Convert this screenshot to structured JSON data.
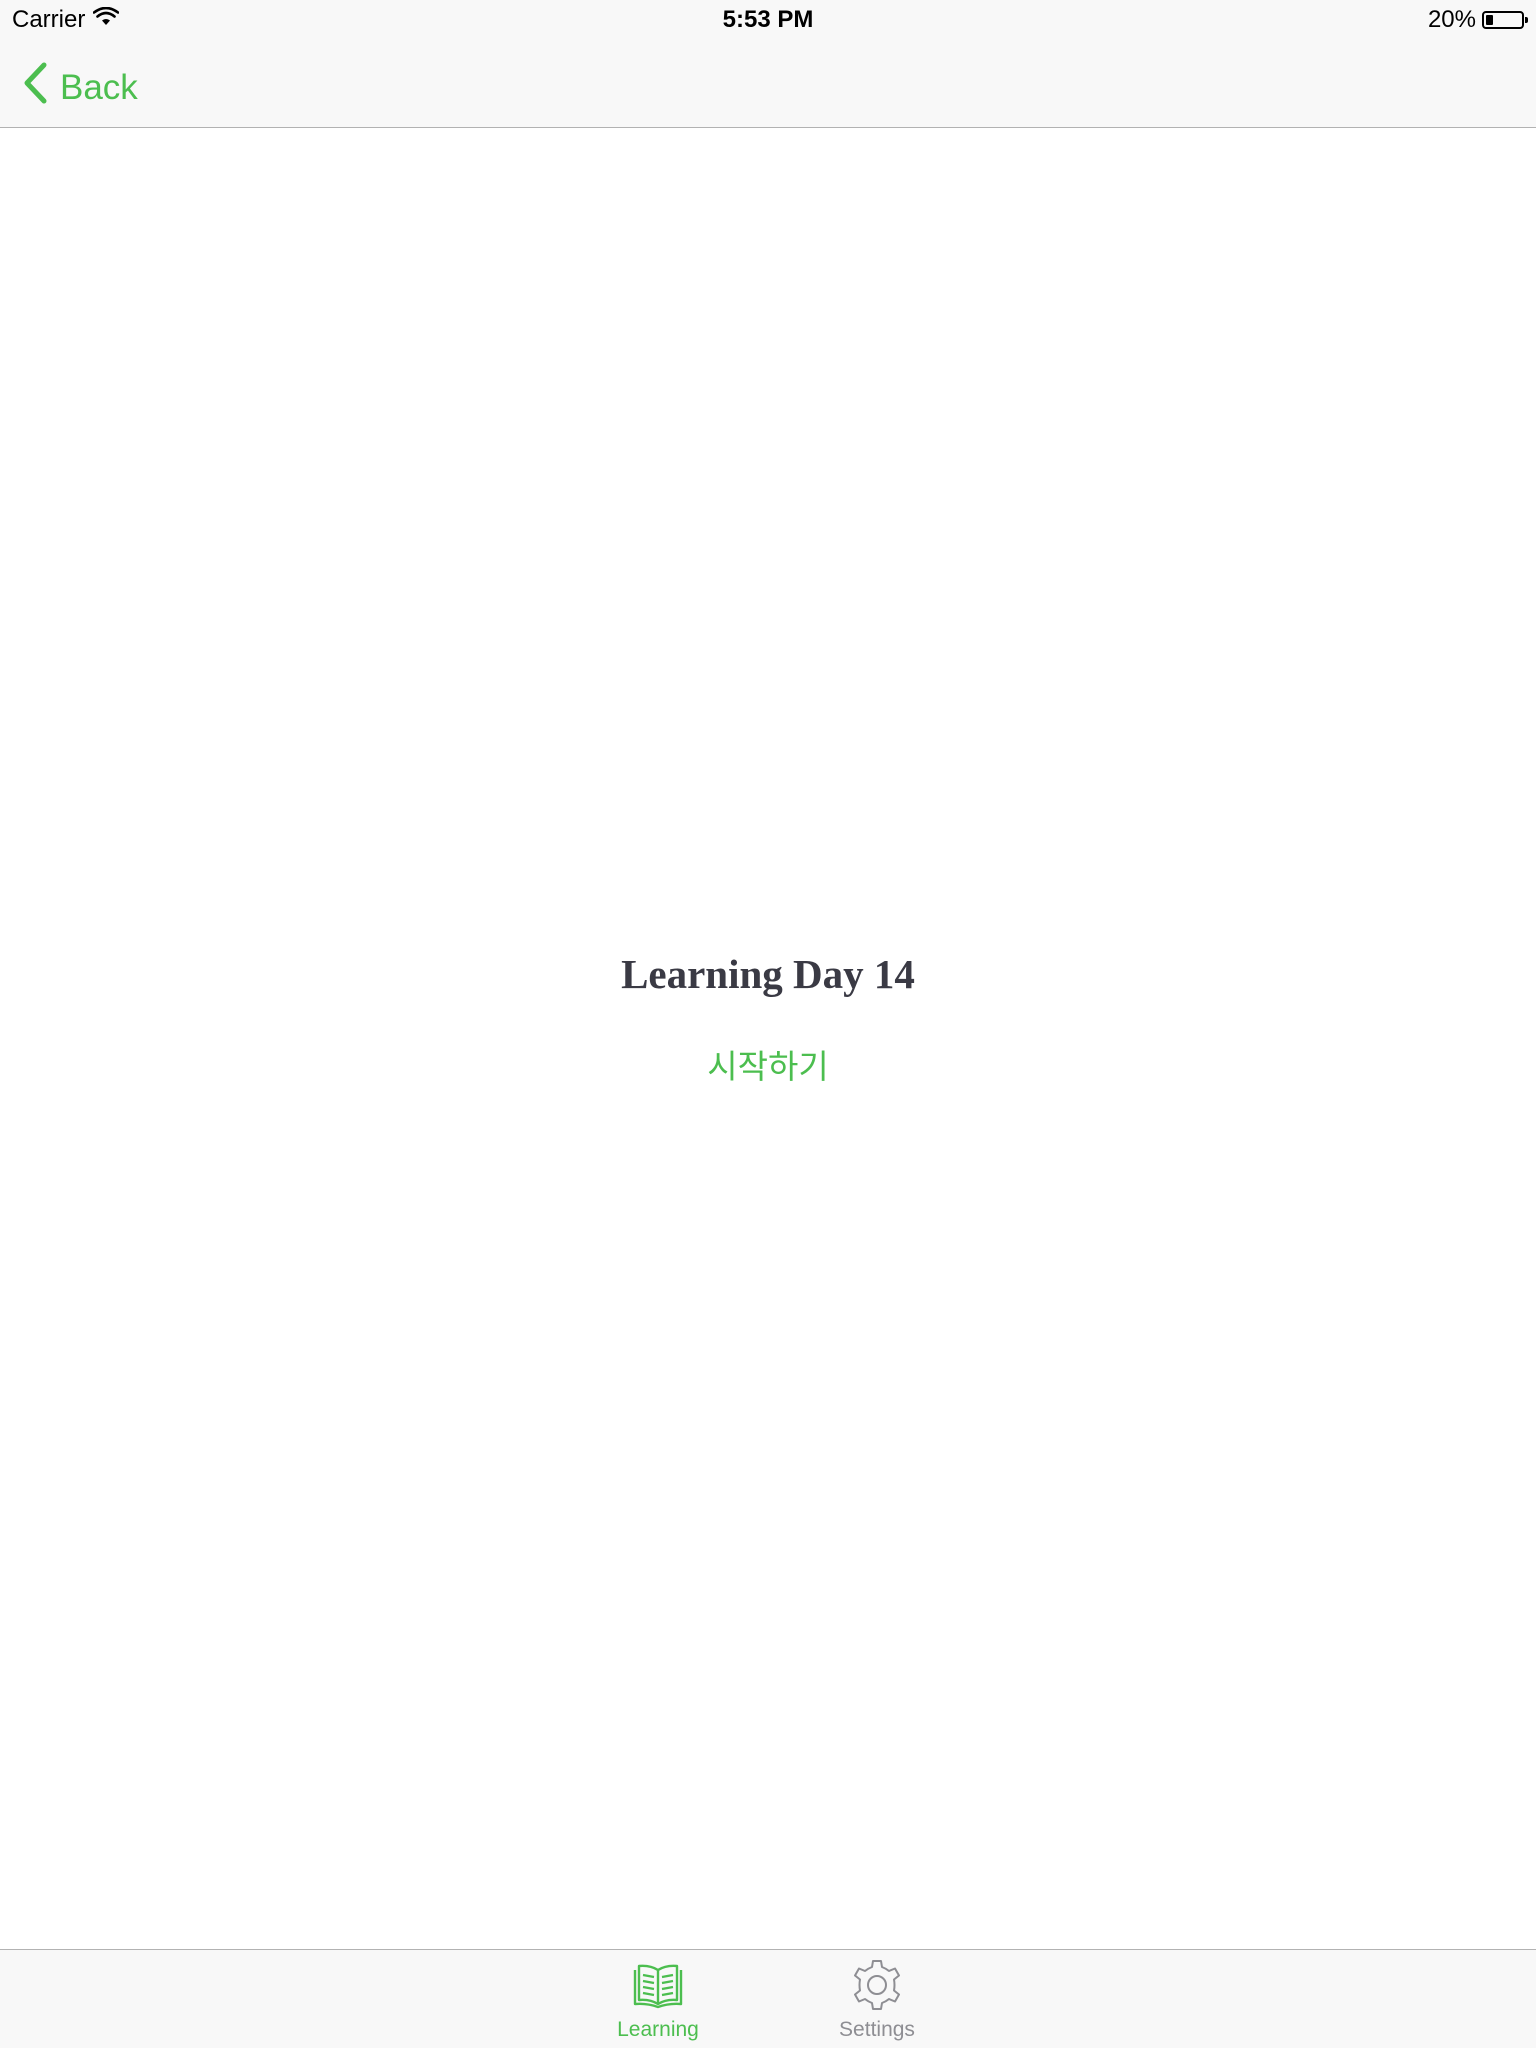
{
  "status_bar": {
    "carrier": "Carrier",
    "time": "5:53 PM",
    "battery_percent": "20%",
    "battery_level": 0.2
  },
  "nav": {
    "back_label": "Back"
  },
  "content": {
    "title": "Learning Day 14",
    "start_label": "시작하기"
  },
  "tabs": [
    {
      "label": "Learning",
      "icon": "book-icon",
      "active": true
    },
    {
      "label": "Settings",
      "icon": "gear-icon",
      "active": false
    }
  ],
  "colors": {
    "accent": "#4cbe4f",
    "title_text": "#3a3a44",
    "inactive_tab": "#8e8e93",
    "bar_background": "#f8f8f8"
  }
}
